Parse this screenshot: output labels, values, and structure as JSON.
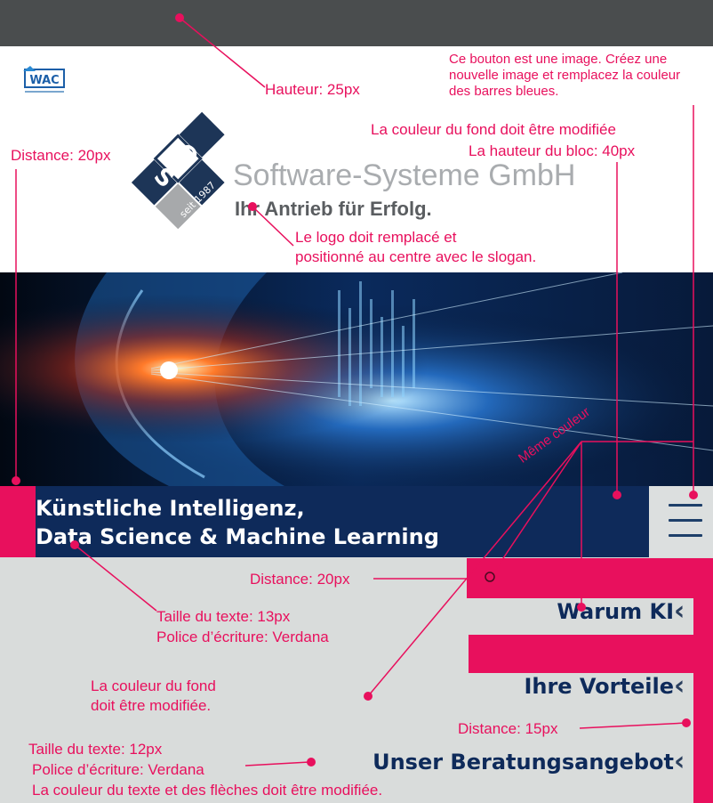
{
  "logos": {
    "wac_text": "WAC",
    "dos_letters": [
      "D",
      "O",
      "S"
    ],
    "dos_seal": "seit 1987"
  },
  "company": {
    "name": "Software-Systeme GmbH",
    "slogan": "Ihr Antrieb für Erfolg."
  },
  "banner": {
    "line1": "Künstliche Intelligenz,",
    "line2": "Data Science & Machine Learning"
  },
  "nav": {
    "items": [
      {
        "label": "Warum KI"
      },
      {
        "label": "Ihre Vorteile"
      },
      {
        "label": "Unser Beratungsangebot"
      }
    ]
  },
  "annotations": {
    "hauteur": "Hauteur: 25px",
    "bouton_image": [
      "Ce bouton est une image. Créez une",
      "nouvelle image et remplacez la couleur",
      "des barres bleues."
    ],
    "fond_modifie": "La couleur du fond doit être modifiée",
    "hauteur_bloc": "La hauteur du bloc: 40px",
    "distance_left": "Distance: 20px",
    "logo_remplace": [
      "Le logo doit remplacé et",
      "positionné au centre avec le slogan."
    ],
    "meme_couleur": "Même couleur",
    "distance_mid": "Distance: 20px",
    "taille_13": "Taille du texte: 13px",
    "police_verdana_1": "Police d’écriture: Verdana",
    "fond_modifie_2": [
      "La couleur du fond",
      "doit être modifiée."
    ],
    "distance_15": "Distance: 15px",
    "taille_12": "Taille du texte: 12px",
    "police_verdana_2": "Police d’écriture: Verdana",
    "couleur_fleches": "La couleur du texte et des flèches doit être modifiée."
  },
  "colors": {
    "accent": "#e8105d",
    "banner_blue": "#0e2a5a",
    "nav_text": "#0e2a5a",
    "background": "#d9dcdb",
    "topbar": "#4a4d4e"
  }
}
